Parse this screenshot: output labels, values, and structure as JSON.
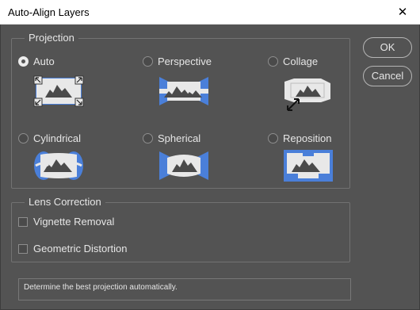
{
  "window": {
    "title": "Auto-Align Layers",
    "close_glyph": "✕"
  },
  "projection": {
    "legend": "Projection",
    "selected": "Auto",
    "options": [
      {
        "label": "Auto",
        "checked": true,
        "thumb": "auto"
      },
      {
        "label": "Perspective",
        "checked": false,
        "thumb": "perspective"
      },
      {
        "label": "Collage",
        "checked": false,
        "thumb": "collage"
      },
      {
        "label": "Cylindrical",
        "checked": false,
        "thumb": "cylindrical"
      },
      {
        "label": "Spherical",
        "checked": false,
        "thumb": "spherical"
      },
      {
        "label": "Reposition",
        "checked": false,
        "thumb": "reposition"
      }
    ]
  },
  "lens_correction": {
    "legend": "Lens Correction",
    "options": [
      {
        "label": "Vignette Removal",
        "checked": false
      },
      {
        "label": "Geometric Distortion",
        "checked": false
      }
    ]
  },
  "buttons": {
    "ok": "OK",
    "cancel": "Cancel"
  },
  "status_text": "Determine the best projection automatically.",
  "colors": {
    "accent_blue": "#4a7fd9",
    "image_white": "#e8e8e8",
    "mountain": "#4a4a4a",
    "dialog_bg": "#535353"
  }
}
